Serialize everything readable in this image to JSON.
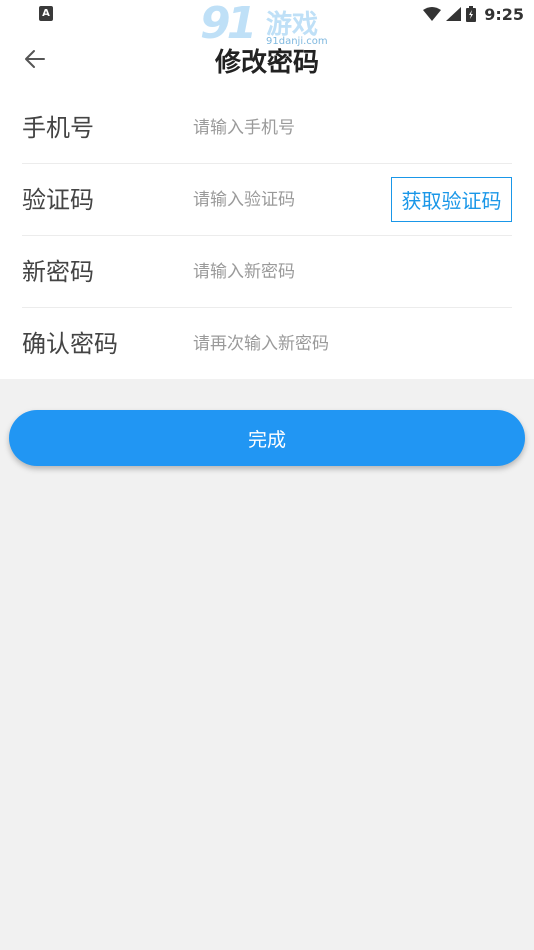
{
  "status_bar": {
    "time": "9:25",
    "app_icon_letter": "A"
  },
  "watermark": {
    "number": "91",
    "text": "游戏",
    "domain": "91danji.com"
  },
  "header": {
    "title": "修改密码"
  },
  "form": {
    "rows": [
      {
        "label": "手机号",
        "placeholder": "请输入手机号"
      },
      {
        "label": "验证码",
        "placeholder": "请输入验证码",
        "action_label": "获取验证码"
      },
      {
        "label": "新密码",
        "placeholder": "请输入新密码"
      },
      {
        "label": "确认密码",
        "placeholder": "请再次输入新密码"
      }
    ]
  },
  "submit": {
    "label": "完成"
  },
  "colors": {
    "accent": "#2196f3",
    "link": "#1a97e8",
    "background": "#f1f1f1"
  }
}
